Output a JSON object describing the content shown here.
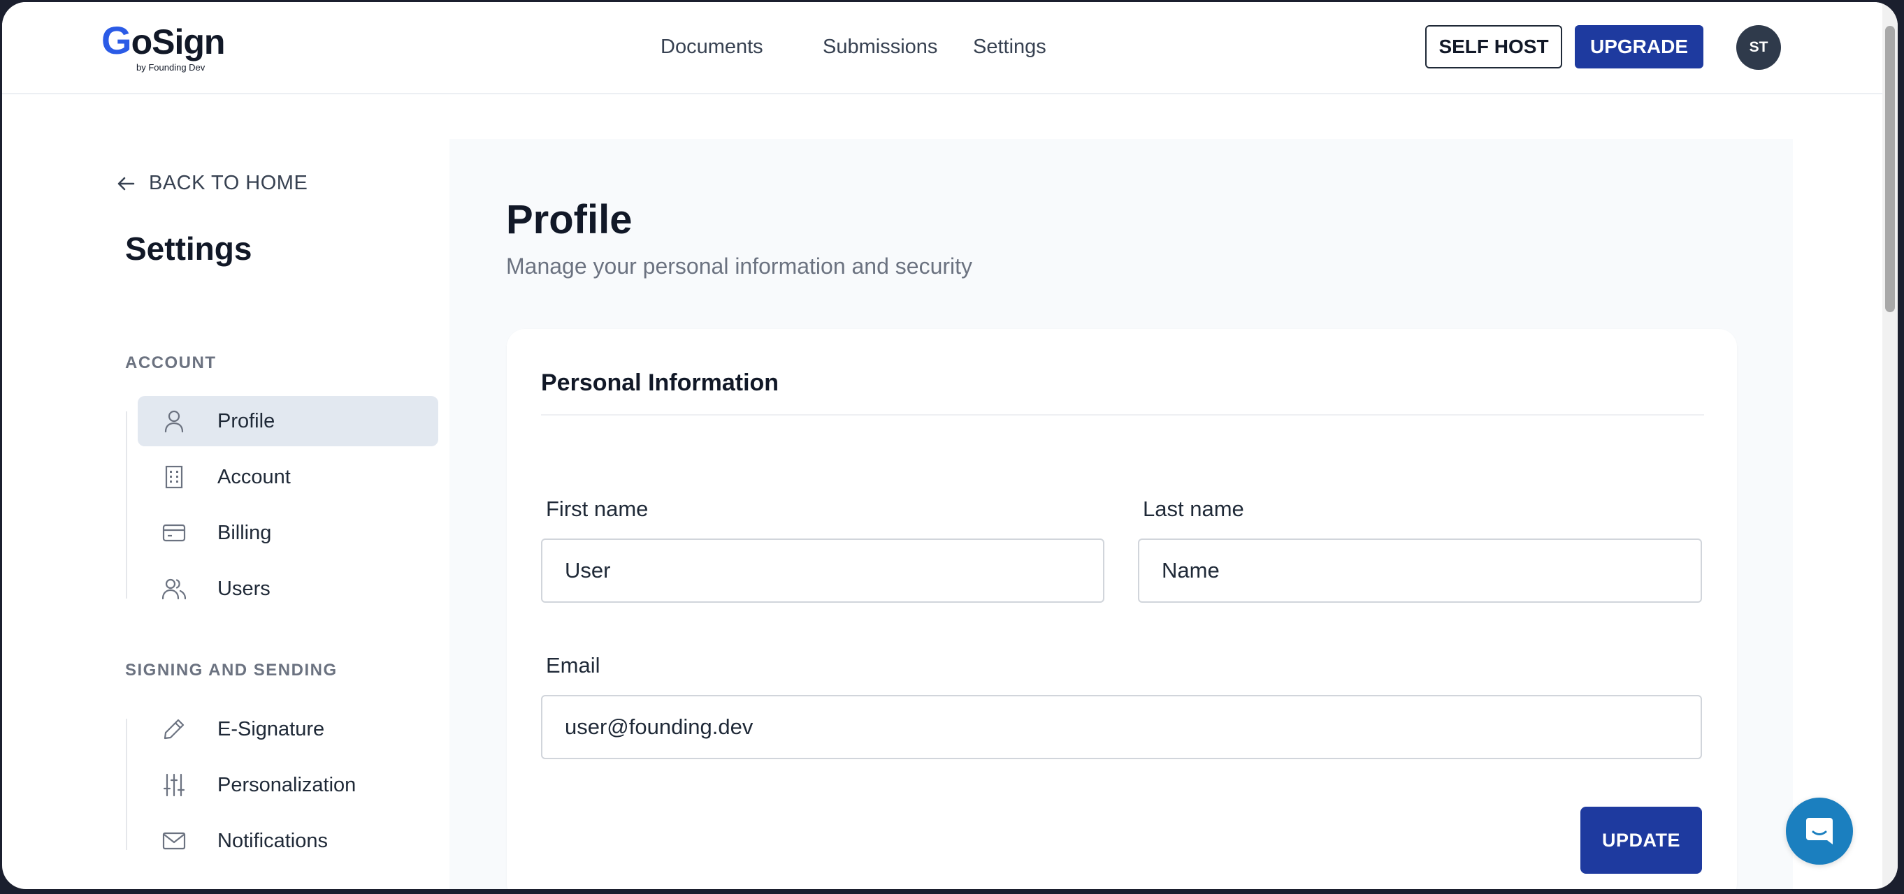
{
  "app": {
    "logo_text": "GoSign",
    "logo_first_letter": "G",
    "logo_rest": "oSign",
    "logo_sub": "by Founding Dev"
  },
  "header": {
    "nav": [
      {
        "label": "Documents"
      },
      {
        "label": "Submissions"
      },
      {
        "label": "Settings"
      }
    ],
    "self_host_label": "SELF HOST",
    "upgrade_label": "UPGRADE",
    "avatar_initials": "ST"
  },
  "sidebar": {
    "back_label": "BACK TO HOME",
    "title": "Settings",
    "sections": [
      {
        "label": "ACCOUNT",
        "items": [
          {
            "label": "Profile",
            "icon": "user-icon",
            "active": true
          },
          {
            "label": "Account",
            "icon": "building-icon"
          },
          {
            "label": "Billing",
            "icon": "credit-card-icon"
          },
          {
            "label": "Users",
            "icon": "users-icon"
          }
        ]
      },
      {
        "label": "SIGNING AND SENDING",
        "items": [
          {
            "label": "E-Signature",
            "icon": "pencil-icon"
          },
          {
            "label": "Personalization",
            "icon": "sliders-icon"
          },
          {
            "label": "Notifications",
            "icon": "mail-icon"
          }
        ]
      }
    ]
  },
  "main": {
    "title": "Profile",
    "subtitle": "Manage your personal information and security",
    "card": {
      "title": "Personal Information",
      "first_name_label": "First name",
      "first_name_value": "User",
      "last_name_label": "Last name",
      "last_name_value": "Name",
      "email_label": "Email",
      "email_value": "user@founding.dev",
      "update_label": "UPDATE"
    }
  },
  "colors": {
    "primary": "#1e3a9f",
    "logo_accent": "#2b5be6",
    "chat_button": "#1b7fbf",
    "active_item_bg": "#e2e8f0"
  }
}
